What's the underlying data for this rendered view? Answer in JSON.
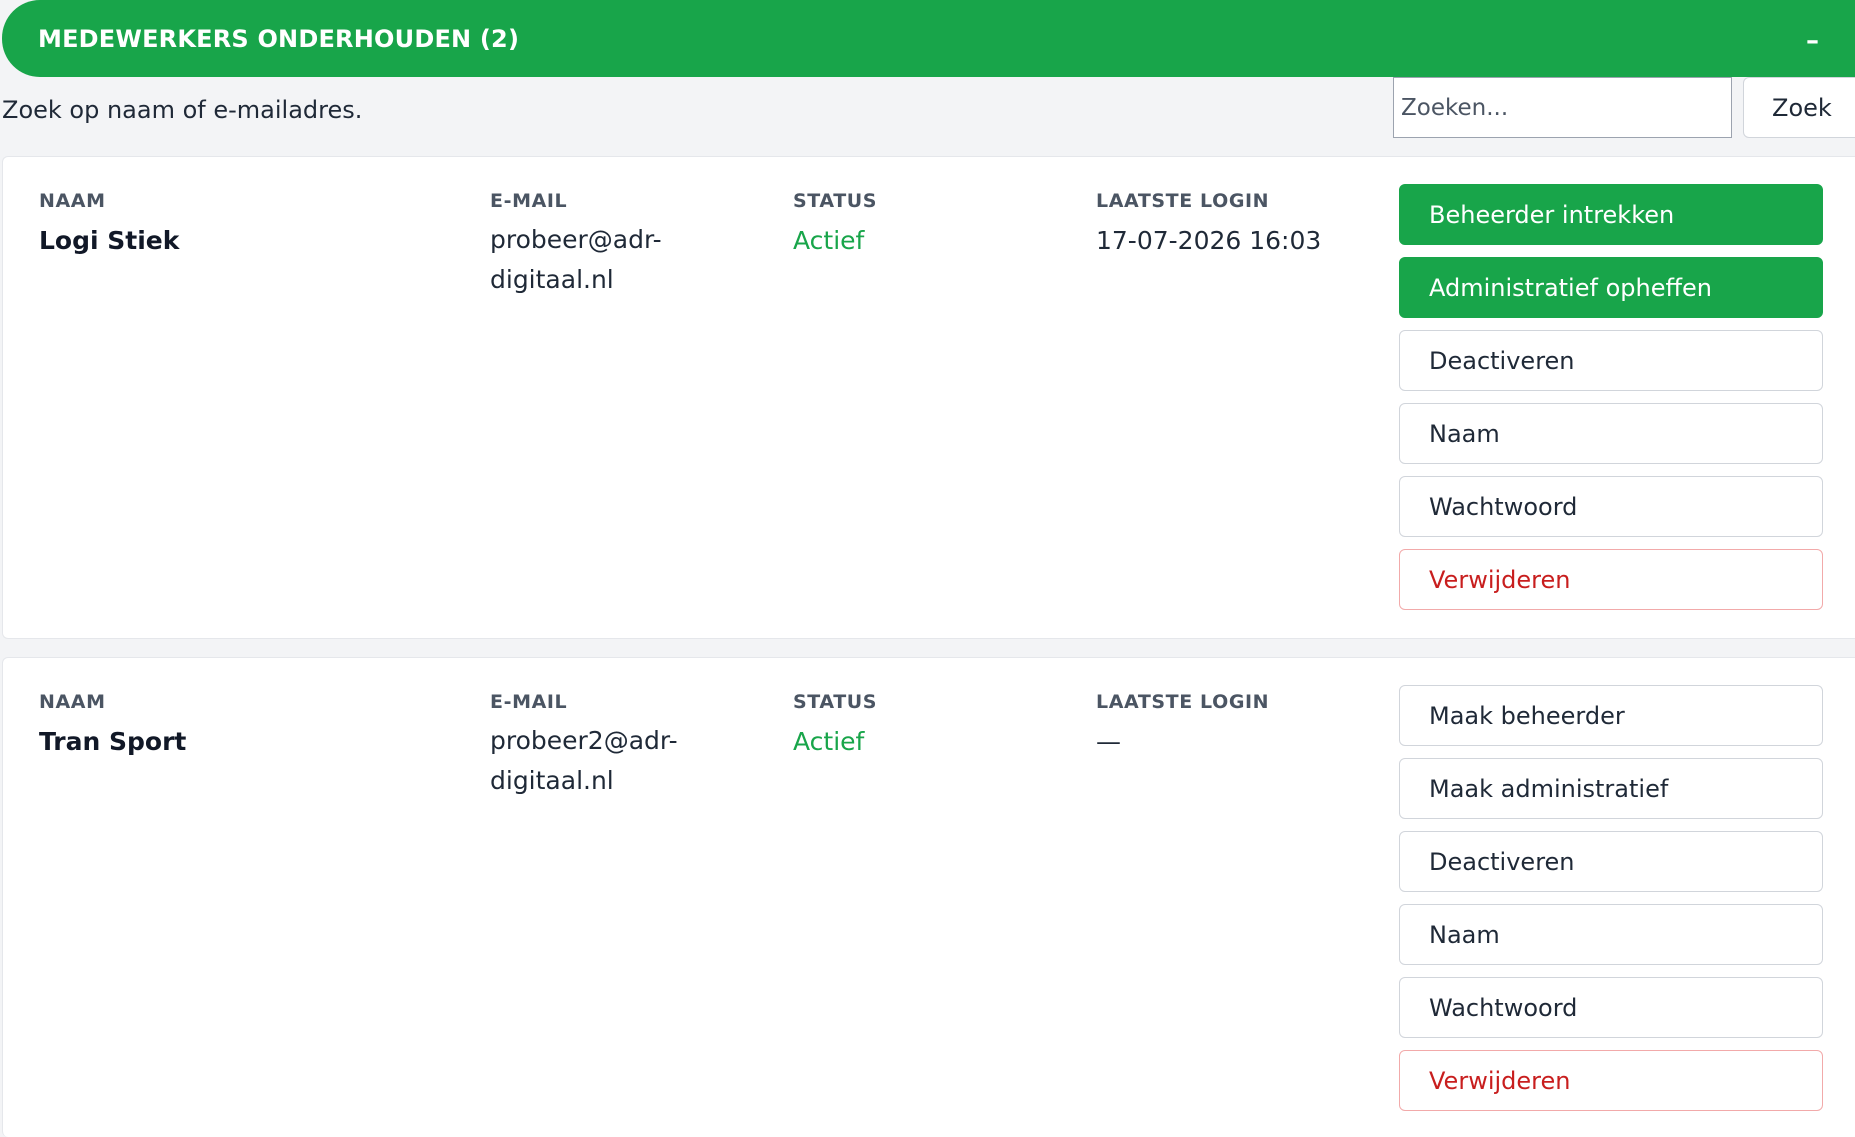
{
  "header": {
    "title": "MEDEWERKERS ONDERHOUDEN (2)",
    "collapse_symbol": "–",
    "icon": "minus-icon"
  },
  "search": {
    "hint": "Zoek op naam of e-mailadres.",
    "placeholder": "Zoeken...",
    "value": "",
    "button_label": "Zoek"
  },
  "columns": {
    "name": "NAAM",
    "email": "E-MAIL",
    "status": "STATUS",
    "last_login": "LAATSTE LOGIN"
  },
  "employees": [
    {
      "name": "Logi Stiek",
      "email": "probeer@adr-digitaal.nl",
      "status": "Actief",
      "last_login": "17-07-2026 16:03",
      "actions": {
        "admin": "Beheerder intrekken",
        "administrative": "Administratief opheffen",
        "deactivate": "Deactiveren",
        "rename": "Naam",
        "password": "Wachtwoord",
        "delete": "Verwijderen"
      }
    },
    {
      "name": "Tran Sport",
      "email": "probeer2@adr-digitaal.nl",
      "status": "Actief",
      "last_login": "—",
      "actions": {
        "admin": "Maak beheerder",
        "administrative": "Maak administratief",
        "deactivate": "Deactiveren",
        "rename": "Naam",
        "password": "Wachtwoord",
        "delete": "Verwijderen"
      }
    }
  ],
  "colors": {
    "brand_green": "#18a54a",
    "danger_red": "#c81e1e",
    "background": "#f3f4f6"
  }
}
